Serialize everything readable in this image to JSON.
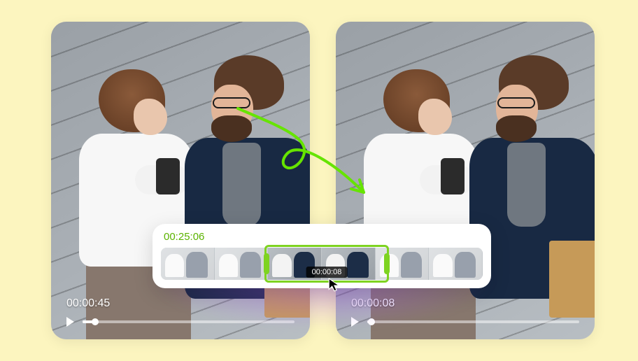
{
  "left_player": {
    "timestamp": "00:00:45",
    "progress_pct": 6
  },
  "right_player": {
    "timestamp": "00:00:08",
    "progress_pct": 2
  },
  "trimmer": {
    "total_label": "00:25:06",
    "selection_label": "00:00:08"
  },
  "colors": {
    "accent_green": "#7ed321",
    "arrow_green": "#66e400"
  }
}
